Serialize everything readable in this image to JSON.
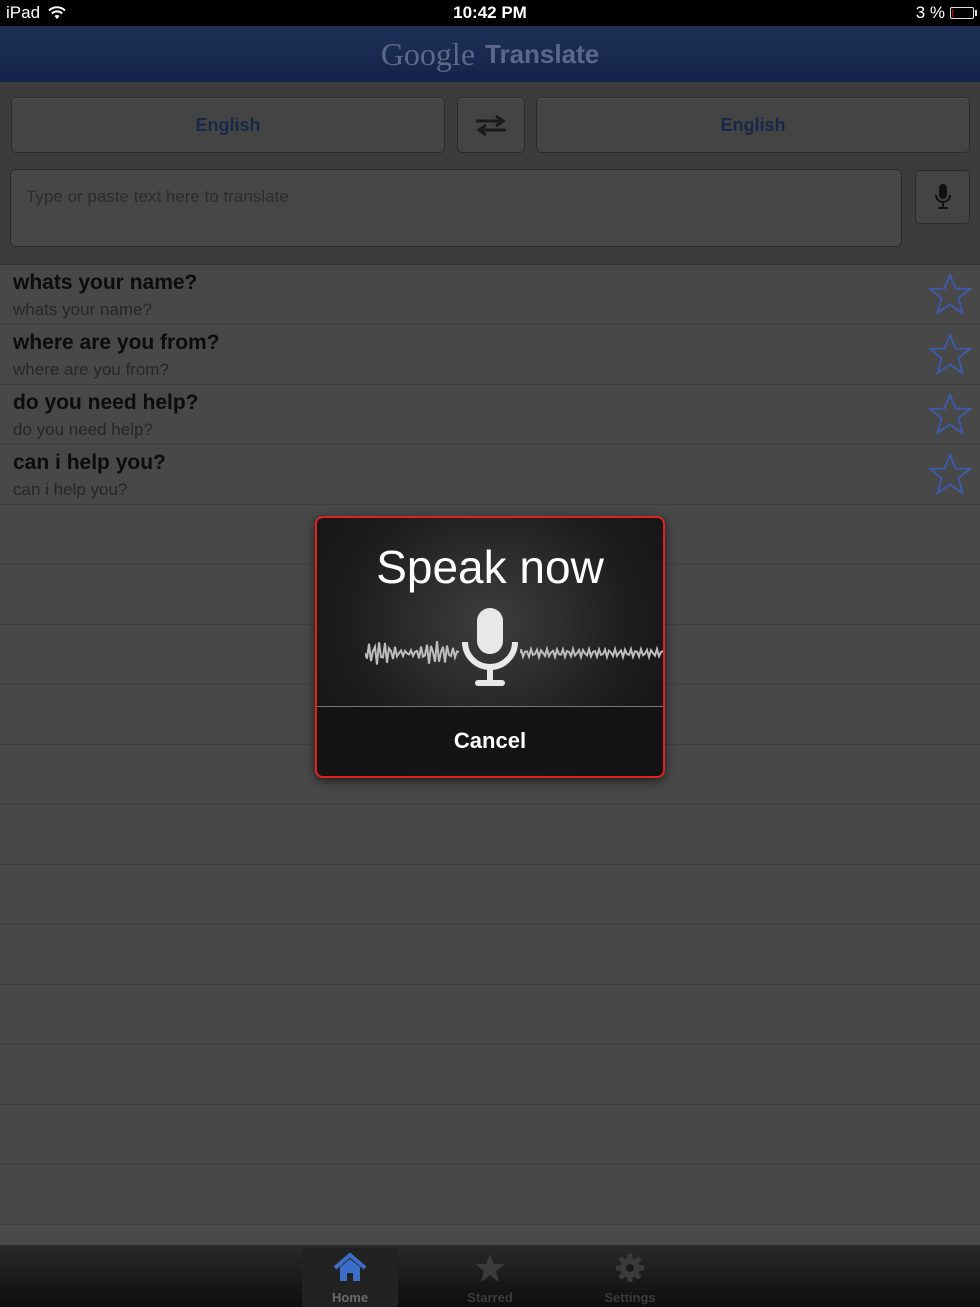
{
  "status": {
    "device": "iPad",
    "time": "10:42 PM",
    "battery": "3 %",
    "battery_level": 0.03
  },
  "header": {
    "logo": "Google",
    "title": "Translate"
  },
  "languages": {
    "source": "English",
    "target": "English"
  },
  "input": {
    "placeholder": "Type or paste text here to translate",
    "value": ""
  },
  "history": [
    {
      "source": "whats your name?",
      "translation": "whats your name?"
    },
    {
      "source": "where are you from?",
      "translation": "where are you from?"
    },
    {
      "source": "do you need help?",
      "translation": "do you need help?"
    },
    {
      "source": "can i help you?",
      "translation": "can i help you?"
    }
  ],
  "dialog": {
    "heading": "Speak now",
    "cancel": "Cancel"
  },
  "tabs": [
    {
      "label": "Home",
      "icon": "home-icon",
      "active": true
    },
    {
      "label": "Starred",
      "icon": "star-icon",
      "active": false
    },
    {
      "label": "Settings",
      "icon": "gear-icon",
      "active": false
    }
  ],
  "colors": {
    "accent": "#182848",
    "dialog_border": "#dd2222",
    "star": "#3d5aa6"
  }
}
